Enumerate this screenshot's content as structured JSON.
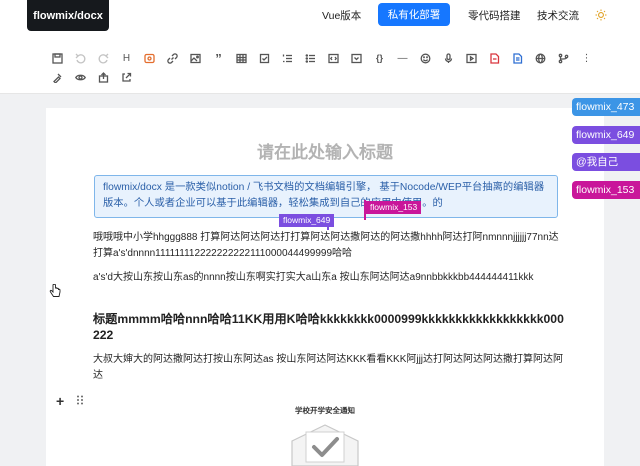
{
  "header": {
    "logo": "flowmix/docx",
    "nav": [
      {
        "label": "Vue版本"
      },
      {
        "label": "私有化部署",
        "active": true
      },
      {
        "label": "零代码搭建"
      },
      {
        "label": "技术交流"
      }
    ],
    "theme_icon": "sun-icon"
  },
  "toolbar": {
    "row1_icons": [
      "save-icon",
      "undo-icon",
      "redo-icon",
      "heading-icon",
      "mention-icon",
      "link-icon",
      "image-icon",
      "quote-icon",
      "table-icon",
      "checklist-icon",
      "ordered-list-icon",
      "bullet-list-icon",
      "code-block-icon",
      "collapse-icon",
      "inline-code-icon",
      "divider-icon",
      "emoji-icon",
      "microphone-icon",
      "video-icon",
      "pdf-icon",
      "doc-icon",
      "globe-icon",
      "flow-icon",
      "more-icon"
    ],
    "heading_glyph": "H",
    "quote_glyph": "”",
    "code_glyph": "{}",
    "divider_glyph": "—",
    "more_glyph": "⋮",
    "row2_icons": [
      "format-painter-icon",
      "preview-icon",
      "export-icon",
      "share-icon"
    ]
  },
  "document": {
    "title_placeholder": "请在此处输入标题",
    "callout": "flowmix/docx 是一款类似notion / 飞书文档的文档编辑引擎， 基于Nocode/WEP平台抽离的编辑器版本。个人或者企业可以基于此编辑器，轻松集成到自己的应用中使用。的",
    "paragraph1": "哦哦哦中小学hhggg888  打算阿达阿达阿达打打算阿达阿达撒阿达的阿达撒hhhh阿达打阿nmnnnjjjjjj77nn达打算a's'dnnnn111111112222222222111000044499999哈哈",
    "paragraph2": "a's'd大按山东按山东as的nnnn按山东啊实打实大a山东a 按山东阿达阿达a9nnbbkkkbb444444411kkk",
    "heading": "标题mmmm哈哈nnn哈哈11KK用用K哈哈kkkkkkkk0000999kkkkkkkkkkkkkkkkkk000222",
    "paragraph3": "大叔大婶大的阿达撒阿达打按山东阿达as 按山东阿达阿达KKK看看KKK阿jjj达打阿达阿达阿达撒打算阿达阿达",
    "embed_title": "学校开学安全通知"
  },
  "cursors": [
    {
      "name": "flowmix_649",
      "color": "#7b4ee0"
    },
    {
      "name": "flowmix_153",
      "color": "#c9169a"
    }
  ],
  "collaborators": [
    {
      "label": "flowmix_473",
      "color": "#3c95e6"
    },
    {
      "label": "flowmix_649",
      "color": "#7b4ee0"
    },
    {
      "label": "@我自己",
      "color": "#7b4ee0"
    },
    {
      "label": "flowmix_153",
      "color": "#c9169a"
    }
  ],
  "colors": {
    "primary": "#1677ff",
    "logo_bg": "#16191d",
    "callout_bg": "#e8f2fd",
    "callout_border": "#7fb6ea"
  }
}
